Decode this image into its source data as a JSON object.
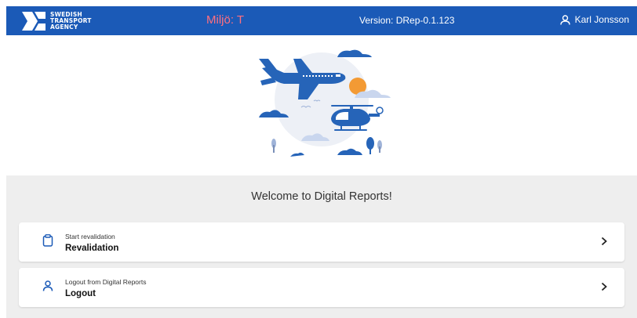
{
  "header": {
    "logo_lines": [
      "SWEDISH",
      "TRANSPORT",
      "AGENCY"
    ],
    "environment": "Miljö: T",
    "version": "Version: DRep-0.1.123",
    "user_name": "Karl Jonsson"
  },
  "main": {
    "welcome": "Welcome to Digital Reports!",
    "cards": [
      {
        "subtitle": "Start revalidation",
        "title": "Revalidation",
        "icon": "clipboard-icon"
      },
      {
        "subtitle": "Logout from Digital Reports",
        "title": "Logout",
        "icon": "user-icon"
      }
    ]
  },
  "colors": {
    "header_bg": "#1b5ab7",
    "environment_text": "#ff6f7f",
    "illustration_blue": "#2664b8",
    "sun": "#f39a34",
    "panel_bg": "#eeeeee"
  }
}
